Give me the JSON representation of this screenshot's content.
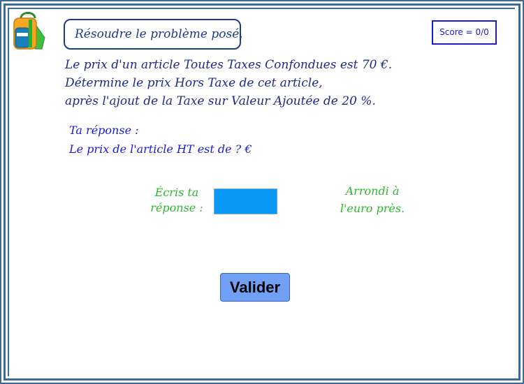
{
  "header": {
    "instruction": "Résoudre le problème posé.",
    "score": "Score = 0/0",
    "logo_icon": "backpack-icon"
  },
  "problem": {
    "lines": [
      "Le prix d'un article Toutes Taxes Confondues est 70 €.",
      "Détermine le prix Hors Taxe  de cet article,",
      "après l'ajout de la Taxe sur Valeur Ajoutée de 20 %."
    ]
  },
  "answer": {
    "lines": [
      "Ta réponse :",
      "Le prix de l'article HT est de ? €"
    ],
    "input_label_line1": "Écris ta",
    "input_label_line2": "réponse :",
    "input_value": "",
    "round_note_line1": "Arrondi à",
    "round_note_line2": "l'euro près."
  },
  "actions": {
    "validate_label": "Valider"
  },
  "colors": {
    "frame": "#3b6b98",
    "title": "#1e3a8a",
    "score": "#1a1ad0",
    "input_bg": "#0a98f5",
    "green_text": "#2db82d",
    "button_bg": "#6fa0f5"
  }
}
